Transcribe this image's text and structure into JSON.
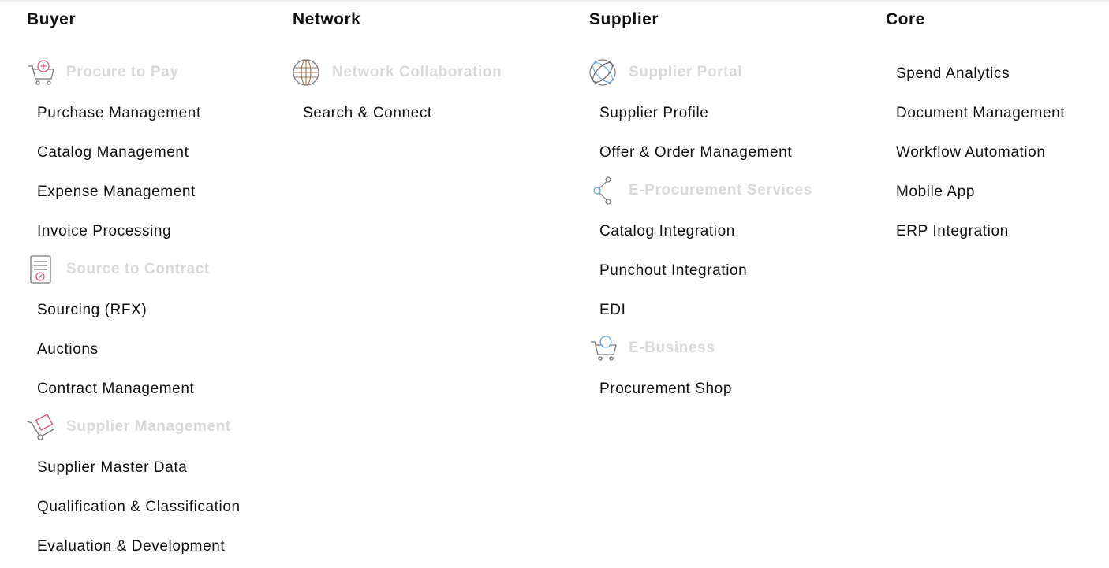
{
  "colors": {
    "category_label": "#d9d9d9",
    "accent_pink": "#d9577a",
    "accent_blue": "#6aa6d8",
    "accent_brown": "#a0704a"
  },
  "columns": [
    {
      "title": "Buyer",
      "groups": [
        {
          "category": {
            "label": "Procure to Pay",
            "icon": "shopping-cart-plus-icon"
          },
          "items": [
            "Purchase Management",
            "Catalog Management",
            "Expense Management",
            "Invoice Processing"
          ]
        },
        {
          "category": {
            "label": "Source to Contract",
            "icon": "contract-document-icon"
          },
          "items": [
            "Sourcing (RFX)",
            "Auctions",
            "Contract Management"
          ]
        },
        {
          "category": {
            "label": "Supplier Management",
            "icon": "hand-truck-icon"
          },
          "items": [
            "Supplier Master Data",
            "Qualification & Classification",
            "Evaluation & Development"
          ]
        }
      ]
    },
    {
      "title": "Network",
      "groups": [
        {
          "category": {
            "label": "Network Collaboration",
            "icon": "globe-grid-icon"
          },
          "items": [
            "Search & Connect"
          ]
        }
      ]
    },
    {
      "title": "Supplier",
      "groups": [
        {
          "category": {
            "label": "Supplier Portal",
            "icon": "globe-orbit-icon"
          },
          "items": [
            "Supplier Profile",
            "Offer & Order Management"
          ]
        },
        {
          "category": {
            "label": "E-Procurement Services",
            "icon": "share-nodes-icon"
          },
          "items": [
            "Catalog Integration",
            "Punchout Integration",
            "EDI"
          ]
        },
        {
          "category": {
            "label": "E-Business",
            "icon": "shopping-cart-globe-icon"
          },
          "items": [
            "Procurement Shop"
          ]
        }
      ]
    },
    {
      "title": "Core",
      "groups": [
        {
          "items": [
            "Spend Analytics",
            "Document Management",
            "Workflow Automation",
            "Mobile App",
            "ERP Integration"
          ]
        }
      ]
    }
  ]
}
